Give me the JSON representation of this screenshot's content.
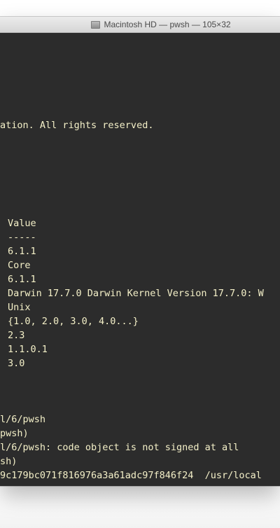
{
  "window": {
    "title": "Macintosh HD — pwsh — 105×32"
  },
  "terminal": {
    "copyright_fragment": "ation. All rights reserved.",
    "table_header": "Value",
    "table_divider": "-----",
    "rows": [
      "6.1.1",
      "Core",
      "6.1.1",
      "Darwin 17.7.0 Darwin Kernel Version 17.7.0: W",
      "Unix",
      "{1.0, 2.0, 3.0, 4.0...}",
      "2.3",
      "1.1.0.1",
      "3.0"
    ],
    "output_lines": [
      "l/6/pwsh",
      "pwsh)",
      "l/6/pwsh: code object is not signed at all",
      "sh)",
      "9c179bc071f816976a3a61adc97f846f24  /usr/local"
    ]
  },
  "colors": {
    "terminal_background": "#2c2c2c",
    "terminal_text": "#f4f0c8",
    "titlebar": "#e3e3e3"
  }
}
